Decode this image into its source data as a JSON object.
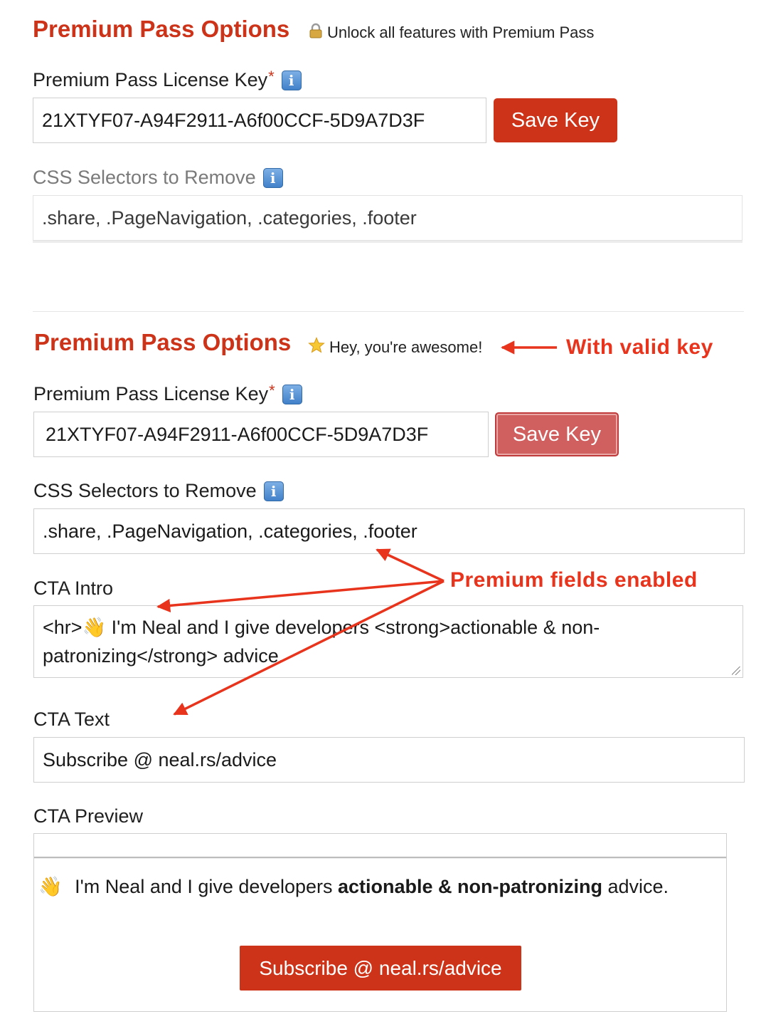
{
  "section1": {
    "title": "Premium Pass Options",
    "status_icon": "lock-icon",
    "status_text": "Unlock all features with Premium Pass",
    "license_label": "Premium Pass License Key",
    "required_mark": "*",
    "license_value": "21XTYF07-A94F2911-A6f00CCF-5D9A7D3F",
    "save_label": "Save Key",
    "css_label": "CSS Selectors to Remove",
    "css_value": ".share, .PageNavigation, .categories, .footer"
  },
  "section2": {
    "title": "Premium Pass Options",
    "status_icon": "star-icon",
    "status_text": "Hey, you're awesome!",
    "license_label": "Premium Pass License Key",
    "required_mark": "*",
    "license_value": "21XTYF07-A94F2911-A6f00CCF-5D9A7D3F",
    "save_label": "Save Key",
    "css_label": "CSS Selectors to Remove",
    "css_value": ".share, .PageNavigation, .categories, .footer",
    "cta_intro_label": "CTA Intro",
    "cta_intro_value": "<hr>👋  I'm Neal and I give developers <strong>actionable & non-patronizing</strong> advice.",
    "cta_text_label": "CTA Text",
    "cta_text_value": "Subscribe @ neal.rs/advice",
    "cta_preview_label": "CTA Preview",
    "preview": {
      "emoji": "👋",
      "text_before": "I'm Neal and I give developers ",
      "text_bold": "actionable & non-patronizing",
      "text_after": " advice.",
      "button_label": "Subscribe @ neal.rs/advice"
    }
  },
  "annotations": {
    "valid_key": "With valid key",
    "premium_fields": "Premium fields enabled",
    "color": "#e8341c"
  },
  "colors": {
    "brand_red": "#cc3318",
    "info_blue": "#3f7fc8"
  }
}
